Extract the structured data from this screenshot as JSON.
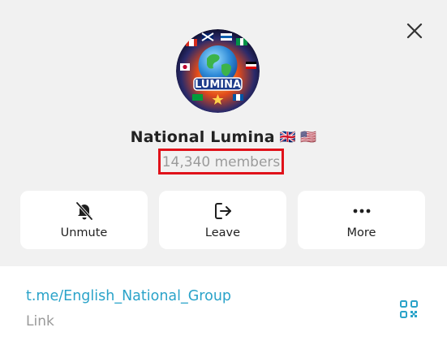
{
  "header": {
    "close_icon": "close-icon"
  },
  "channel": {
    "name": "National Lumina",
    "flags": "🇬🇧 🇺🇸",
    "members": "14,340 members",
    "avatar_text": "LUMINA"
  },
  "actions": [
    {
      "label": "Unmute",
      "icon": "bell-slash-icon"
    },
    {
      "label": "Leave",
      "icon": "leave-icon"
    },
    {
      "label": "More",
      "icon": "more-icon"
    }
  ],
  "info": {
    "link": "t.me/English_National_Group",
    "link_caption": "Link",
    "qr_icon": "qr-code-icon"
  },
  "colors": {
    "accent": "#2aa3c9",
    "highlight_border": "#e0121a",
    "background": "#f1f1f1"
  }
}
